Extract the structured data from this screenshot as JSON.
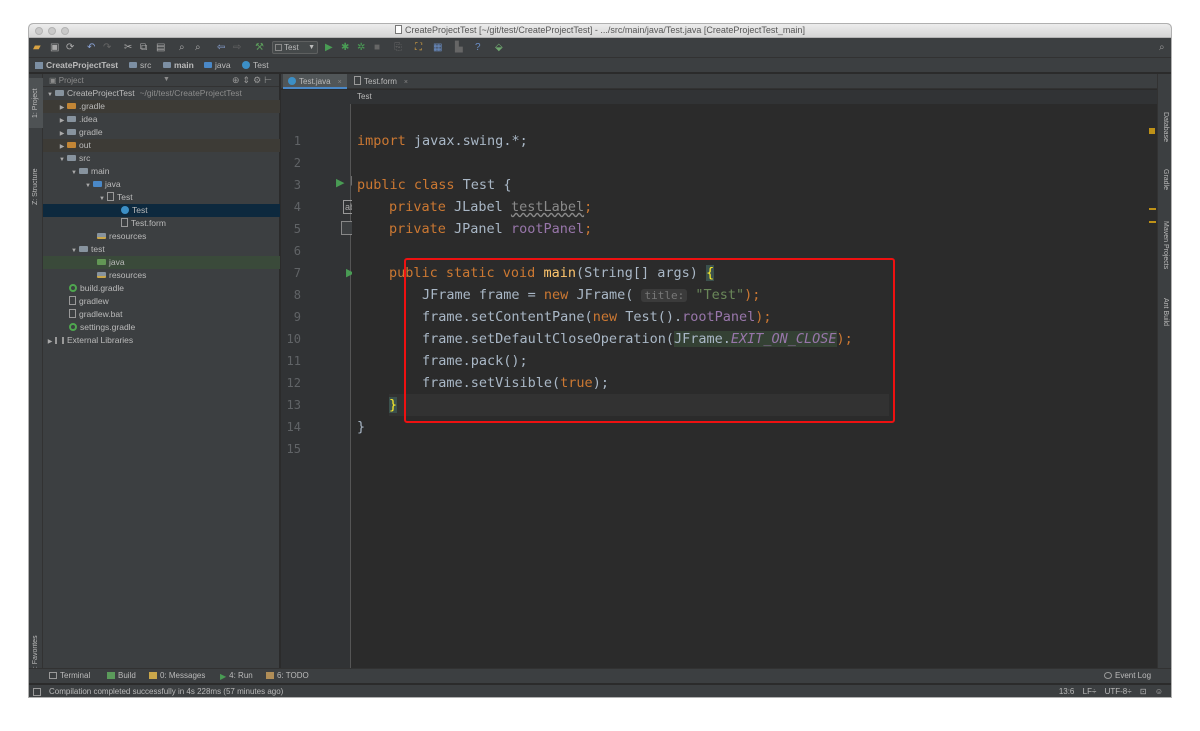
{
  "window": {
    "title": "CreateProjectTest [~/git/test/CreateProjectTest] - .../src/main/java/Test.java [CreateProjectTest_main]"
  },
  "toolbar": {
    "run_config": "Test",
    "icons": [
      "open-icon",
      "save-icon",
      "sync-icon",
      "undo-icon",
      "redo-icon",
      "cut-icon",
      "copy-icon",
      "paste-icon",
      "find-icon",
      "replace-icon",
      "back-icon",
      "forward-icon",
      "build-icon",
      "run-icon",
      "debug-icon",
      "coverage-icon",
      "stop-icon",
      "sdk-icon",
      "structure-icon",
      "help-icon",
      "vcs-icon",
      "search-icon"
    ]
  },
  "navbar": {
    "crumbs": [
      "CreateProjectTest",
      "src",
      "main",
      "java",
      "Test"
    ]
  },
  "left_strip": {
    "project": "1: Project",
    "structure": "Z: Structure",
    "favorites": "2: Favorites"
  },
  "right_strip": {
    "database": "Database",
    "gradle": "Gradle",
    "maven": "Maven Projects",
    "ant": "Ant Build"
  },
  "project_panel": {
    "header": "Project",
    "tree": [
      {
        "label": "CreateProjectTest",
        "path": "~/git/test/CreateProjectTest"
      },
      {
        "label": ".gradle"
      },
      {
        "label": ".idea"
      },
      {
        "label": "gradle"
      },
      {
        "label": "out"
      },
      {
        "label": "src"
      },
      {
        "label": "main"
      },
      {
        "label": "java"
      },
      {
        "label": "Test"
      },
      {
        "label": "Test"
      },
      {
        "label": "Test.form"
      },
      {
        "label": "resources"
      },
      {
        "label": "test"
      },
      {
        "label": "java"
      },
      {
        "label": "resources"
      },
      {
        "label": "build.gradle"
      },
      {
        "label": "gradlew"
      },
      {
        "label": "gradlew.bat"
      },
      {
        "label": "settings.gradle"
      },
      {
        "label": "External Libraries"
      }
    ]
  },
  "editor": {
    "tabs": [
      {
        "label": "Test.java"
      },
      {
        "label": "Test.form"
      }
    ],
    "breadcrumb": "Test",
    "line_numbers": [
      "1",
      "2",
      "3",
      "4",
      "5",
      "6",
      "7",
      "8",
      "9",
      "10",
      "11",
      "12",
      "13",
      "14",
      "15"
    ],
    "code": {
      "l1_kw": "import",
      "l1_rest": " javax.swing.*;",
      "l3_kw": "public class",
      "l3_rest": " Test {",
      "l4_kw": "private",
      "l4_type": " JLabel ",
      "l4_field": "testLabel",
      "l4_end": ";",
      "l5_kw": "private",
      "l5_type": " JPanel ",
      "l5_field": "rootPanel",
      "l5_end": ";",
      "l7_kw": "public static void",
      "l7_fn": "main",
      "l7_rest": "(String[] args) ",
      "l7_brace": "{",
      "l8_a": "JFrame frame = ",
      "l8_kw": "new",
      "l8_b": " JFrame(",
      "l8_hint": "title:",
      "l8_str": "\"Test\"",
      "l8_end": ");",
      "l9_a": "frame.setContentPane(",
      "l9_kw": "new",
      "l9_b": " Test().",
      "l9_field": "rootPanel",
      "l9_end": ");",
      "l10_a": "frame.setDefaultCloseOperation(",
      "l10_b": "JFrame.",
      "l10_const": "EXIT_ON_CLOSE",
      "l10_end": ");",
      "l11": "frame.pack();",
      "l12_a": "frame.setVisible(",
      "l12_kw": "true",
      "l12_end": ");",
      "l13": "}",
      "l14": "}"
    }
  },
  "bottom_tools": {
    "terminal": "Terminal",
    "build": "Build",
    "messages": "0: Messages",
    "run": "4: Run",
    "todo": "6: TODO",
    "event_log": "Event Log"
  },
  "status": {
    "message": "Compilation completed successfully in 4s 228ms (57 minutes ago)",
    "position": "13:6",
    "line_sep": "LF÷",
    "encoding": "UTF-8÷"
  },
  "colors": {
    "highlight": "#ee1111",
    "keyword": "#cc7832",
    "string": "#6a8759",
    "field": "#9876aa",
    "method": "#ffc66d"
  }
}
